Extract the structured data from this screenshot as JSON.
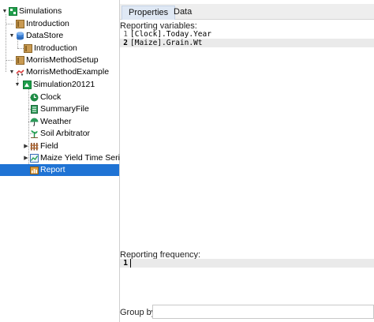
{
  "tree": {
    "root": {
      "label": "Simulations",
      "icon": "simulations-icon"
    },
    "introduction1": {
      "label": "Introduction",
      "icon": "memo-icon"
    },
    "datastore": {
      "label": "DataStore",
      "icon": "database-icon"
    },
    "introduction2": {
      "label": "Introduction",
      "icon": "memo-icon"
    },
    "morrissetup": {
      "label": "MorrisMethodSetup",
      "icon": "memo-icon"
    },
    "morrisexample": {
      "label": "MorrisMethodExample",
      "icon": "morris-icon"
    },
    "simulation": {
      "label": "Simulation20121",
      "icon": "simulation-icon"
    },
    "clock": {
      "label": "Clock",
      "icon": "clock-icon"
    },
    "summaryfile": {
      "label": "SummaryFile",
      "icon": "summary-icon"
    },
    "weather": {
      "label": "Weather",
      "icon": "umbrella-icon"
    },
    "soilarb": {
      "label": "Soil Arbitrator",
      "icon": "soil-icon"
    },
    "field": {
      "label": "Field",
      "icon": "fence-icon"
    },
    "maize": {
      "label": "Maize Yield Time Series",
      "icon": "graph-icon"
    },
    "report": {
      "label": "Report",
      "icon": "report-icon"
    }
  },
  "tabs": [
    {
      "label": "Properties",
      "active": true
    },
    {
      "label": "Data",
      "active": false
    }
  ],
  "reporting": {
    "label": "Reporting variables:",
    "lines": [
      {
        "num": "1",
        "text": "[Clock].Today.Year"
      },
      {
        "num": "2",
        "text": "[Maize].Grain.Wt"
      }
    ]
  },
  "frequency": {
    "label": "Reporting frequency:",
    "lines": [
      {
        "num": "1",
        "text": ""
      }
    ]
  },
  "groupby": {
    "label": "Group by:",
    "value": ""
  },
  "colors": {
    "selection": "#1f73d4",
    "accent_green": "#1e9e4a"
  }
}
